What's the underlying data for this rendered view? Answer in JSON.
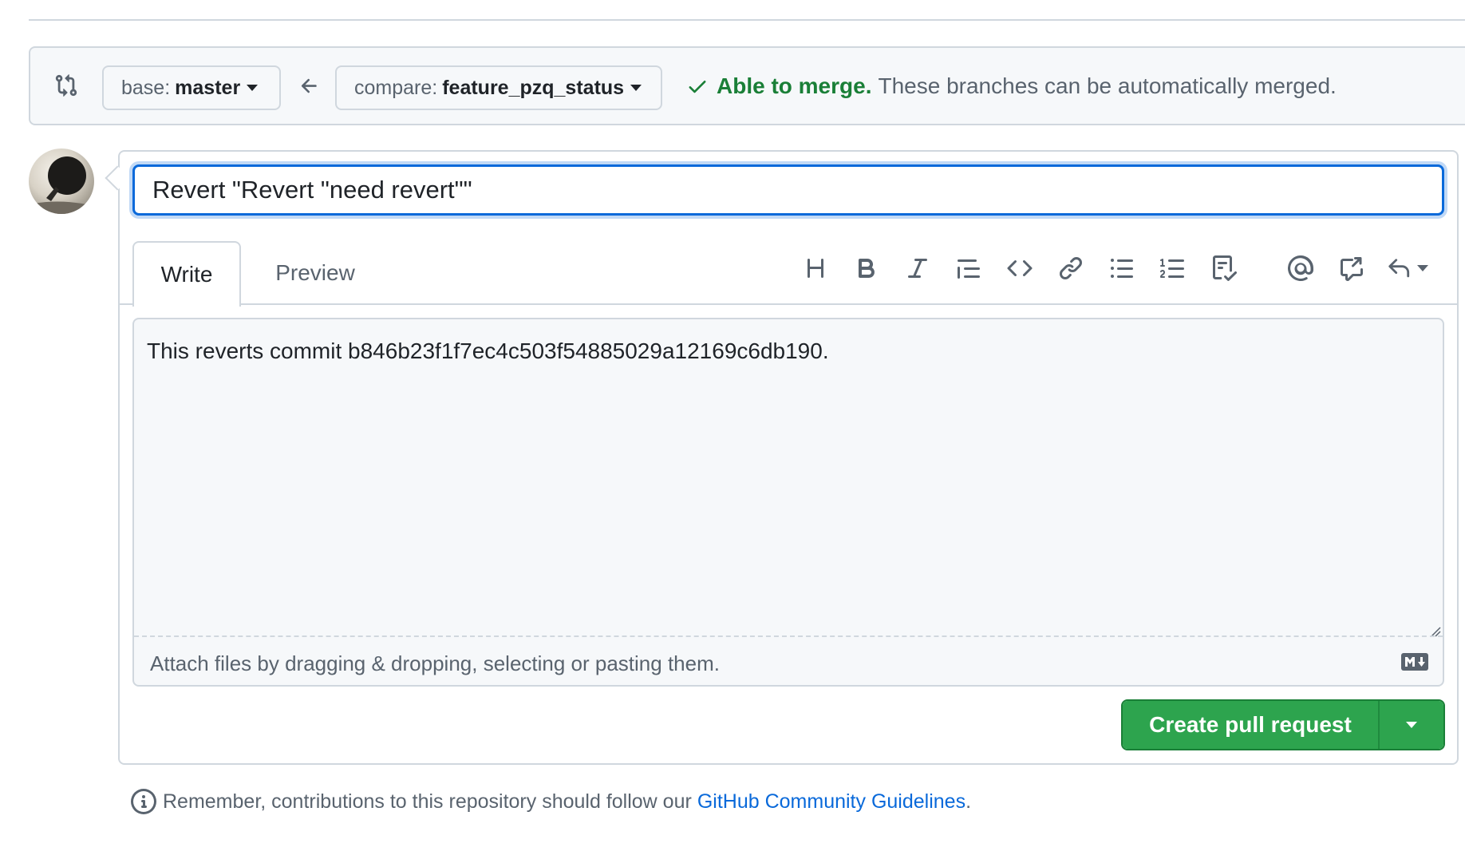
{
  "compare": {
    "base_prefix": "base:",
    "base_branch": "master",
    "compare_prefix": "compare:",
    "compare_branch": "feature_pzq_status",
    "merge_ok": "Able to merge.",
    "merge_detail": "These branches can be automatically merged."
  },
  "pr": {
    "title": "Revert \"Revert \"need revert\"\"",
    "body": "This reverts commit b846b23f1f7ec4c503f54885029a12169c6db190."
  },
  "tabs": {
    "write": "Write",
    "preview": "Preview"
  },
  "toolbar": [
    "heading-icon",
    "bold-icon",
    "italic-icon",
    "quote-icon",
    "code-icon",
    "link-icon",
    "unordered-list-icon",
    "ordered-list-icon",
    "task-list-icon",
    "mention-icon",
    "cross-reference-icon",
    "reply-icon"
  ],
  "attach": {
    "text": "Attach files by dragging & dropping, selecting or pasting them."
  },
  "actions": {
    "create": "Create pull request"
  },
  "note": {
    "text": "Remember, contributions to this repository should follow our",
    "link": "GitHub Community Guidelines",
    "suffix": "."
  },
  "colors": {
    "accent": "#0969da",
    "success": "#1a7f37",
    "button": "#2da44e",
    "border": "#d0d7de"
  }
}
